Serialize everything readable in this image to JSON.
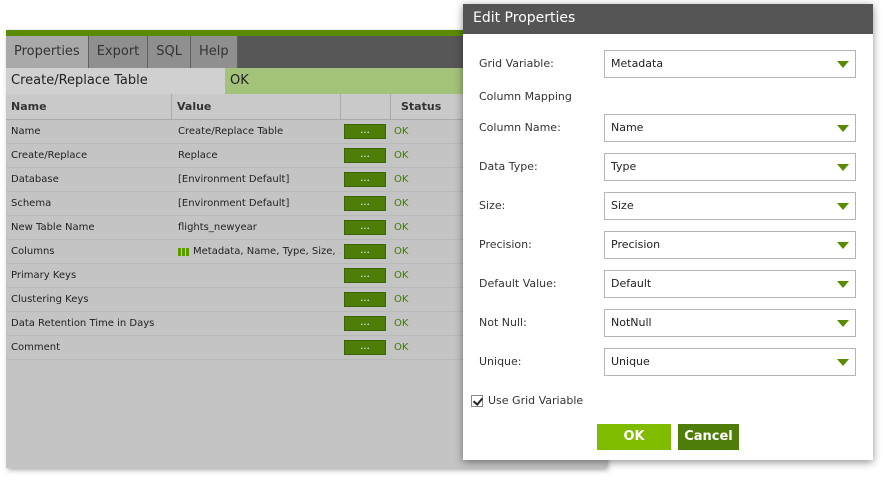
{
  "tabs": [
    "Properties",
    "Export",
    "SQL",
    "Help"
  ],
  "component": {
    "name": "Create/Replace Table",
    "status": "OK"
  },
  "table": {
    "headers": {
      "name": "Name",
      "value": "Value",
      "status": "Status"
    },
    "button_label": "...",
    "rows": [
      {
        "name": "Name",
        "value": "Create/Replace Table",
        "status": "OK"
      },
      {
        "name": "Create/Replace",
        "value": "Replace",
        "status": "OK"
      },
      {
        "name": "Database",
        "value": "[Environment Default]",
        "status": "OK"
      },
      {
        "name": "Schema",
        "value": "[Environment Default]",
        "status": "OK"
      },
      {
        "name": "New Table Name",
        "value": "flights_newyear",
        "status": "OK"
      },
      {
        "name": "Columns",
        "value": "Metadata, Name, Type, Size, ...",
        "status": "OK"
      },
      {
        "name": "Primary Keys",
        "value": "",
        "status": "OK"
      },
      {
        "name": "Clustering Keys",
        "value": "",
        "status": "OK"
      },
      {
        "name": "Data Retention Time in Days",
        "value": "",
        "status": "OK"
      },
      {
        "name": "Comment",
        "value": "",
        "status": "OK"
      }
    ]
  },
  "dialog": {
    "title": "Edit Properties",
    "grid_variable": {
      "label": "Grid Variable:",
      "value": "Metadata"
    },
    "column_mapping_label": "Column Mapping",
    "fields": [
      {
        "label": "Column Name:",
        "value": "Name"
      },
      {
        "label": "Data Type:",
        "value": "Type"
      },
      {
        "label": "Size:",
        "value": "Size"
      },
      {
        "label": "Precision:",
        "value": "Precision"
      },
      {
        "label": "Default Value:",
        "value": "Default"
      },
      {
        "label": "Not Null:",
        "value": "NotNull"
      },
      {
        "label": "Unique:",
        "value": "Unique"
      }
    ],
    "use_grid_variable": {
      "label": "Use Grid Variable",
      "checked": true
    },
    "ok_label": "OK",
    "cancel_label": "Cancel"
  },
  "colors": {
    "accent": "#7fbc00",
    "dark_green": "#4f7d0a",
    "title_bar": "#555555"
  }
}
